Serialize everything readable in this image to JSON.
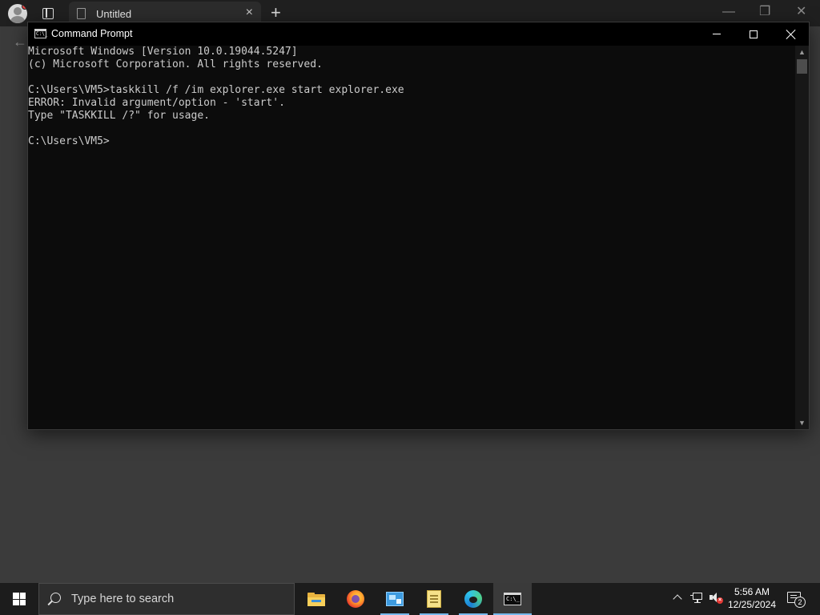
{
  "browser": {
    "tab_title": "Untitled",
    "tab_close": "×",
    "new_tab": "+",
    "back": "←",
    "minimize": "—",
    "restore": "❐",
    "close": "✕"
  },
  "cmd": {
    "title": "Command Prompt",
    "icon_glyph": "C:\\_",
    "lines": [
      "Microsoft Windows [Version 10.0.19044.5247]",
      "(c) Microsoft Corporation. All rights reserved.",
      "",
      "C:\\Users\\VM5>taskkill /f /im explorer.exe start explorer.exe",
      "ERROR: Invalid argument/option - 'start'.",
      "Type \"TASKKILL /?\" for usage.",
      "",
      "C:\\Users\\VM5>"
    ],
    "colors": {
      "console_bg": "#0c0c0c",
      "console_text": "#cccccc",
      "titlebar_bg": "#000000"
    }
  },
  "taskbar": {
    "search_placeholder": "Type here to search",
    "apps": [
      {
        "name": "file-explorer",
        "icon": "folder-icon"
      },
      {
        "name": "firefox",
        "icon": "firefox-icon"
      },
      {
        "name": "control-panel",
        "icon": "control-panel-icon"
      },
      {
        "name": "notepad",
        "icon": "notepad-icon"
      },
      {
        "name": "edge",
        "icon": "edge-icon"
      },
      {
        "name": "command-prompt",
        "icon": "cmd-icon",
        "active": true
      }
    ],
    "cmd_icon_glyph": "C:\\_",
    "tray": {
      "time": "5:56 AM",
      "date": "12/25/2024",
      "notifications_count": "2",
      "volume_muted_glyph": "×"
    },
    "accent": "#76b9ed"
  }
}
